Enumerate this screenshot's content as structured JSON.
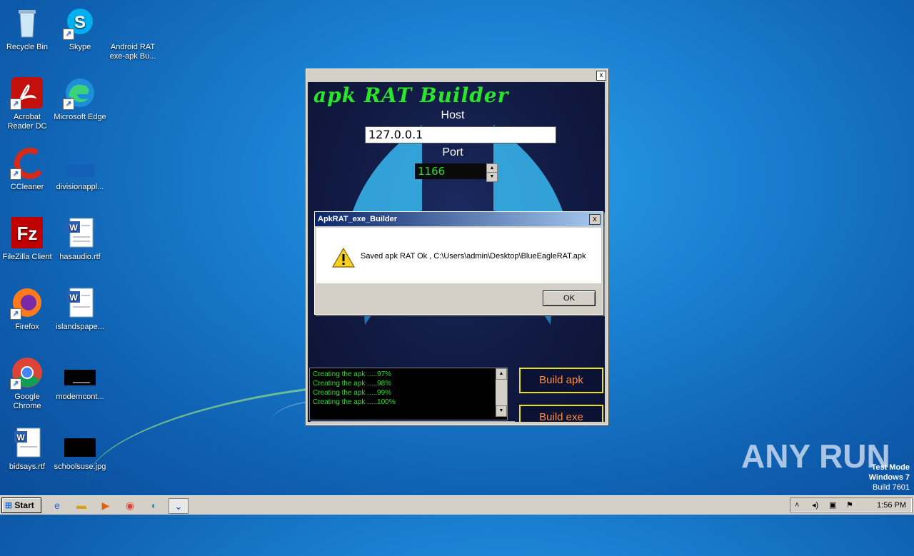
{
  "desktop": {
    "icons": [
      {
        "label": "Recycle Bin"
      },
      {
        "label": "Skype"
      },
      {
        "label": "Android RAT exe-apk Bu..."
      },
      {
        "label": "Acrobat Reader DC"
      },
      {
        "label": "Microsoft Edge"
      },
      {
        "label": "CCleaner"
      },
      {
        "label": "divisionappl..."
      },
      {
        "label": "FileZilla Client"
      },
      {
        "label": "hasaudio.rtf"
      },
      {
        "label": "Firefox"
      },
      {
        "label": "islandspape..."
      },
      {
        "label": "Google Chrome"
      },
      {
        "label": "moderncont..."
      },
      {
        "label": "bidsays.rtf"
      },
      {
        "label": "schoolsuse.jpg"
      }
    ]
  },
  "app": {
    "title": "apk RAT Builder",
    "host_label": "Host",
    "host_value": "127.0.0.1",
    "port_label": "Port",
    "port_value": "1166",
    "log_lines": [
      "Creating the apk .....97%",
      "Creating the apk .....98%",
      "Creating the apk .....99%",
      "Creating the apk .....100%"
    ],
    "build_apk_label": "Build apk",
    "build_exe_label": "Build exe",
    "close_glyph": "x"
  },
  "dialog": {
    "title": "ApkRAT_exe_Builder",
    "message": "Saved apk RAT Ok , C:\\Users\\admin\\Desktop\\BlueEagleRAT.apk",
    "ok_label": "OK",
    "close_glyph": "x"
  },
  "taskbar": {
    "start_label": "Start",
    "clock": "1:56 PM"
  },
  "watermark": "ANY RUN",
  "os_info": {
    "line1": "Test Mode",
    "line2": "Windows 7",
    "line3": "Build 7601"
  },
  "colors": {
    "desktop_bg": "#1a7fd0",
    "app_title": "#28e628",
    "build_btn_border": "#e8e020",
    "build_btn_text": "#ff8c40"
  }
}
